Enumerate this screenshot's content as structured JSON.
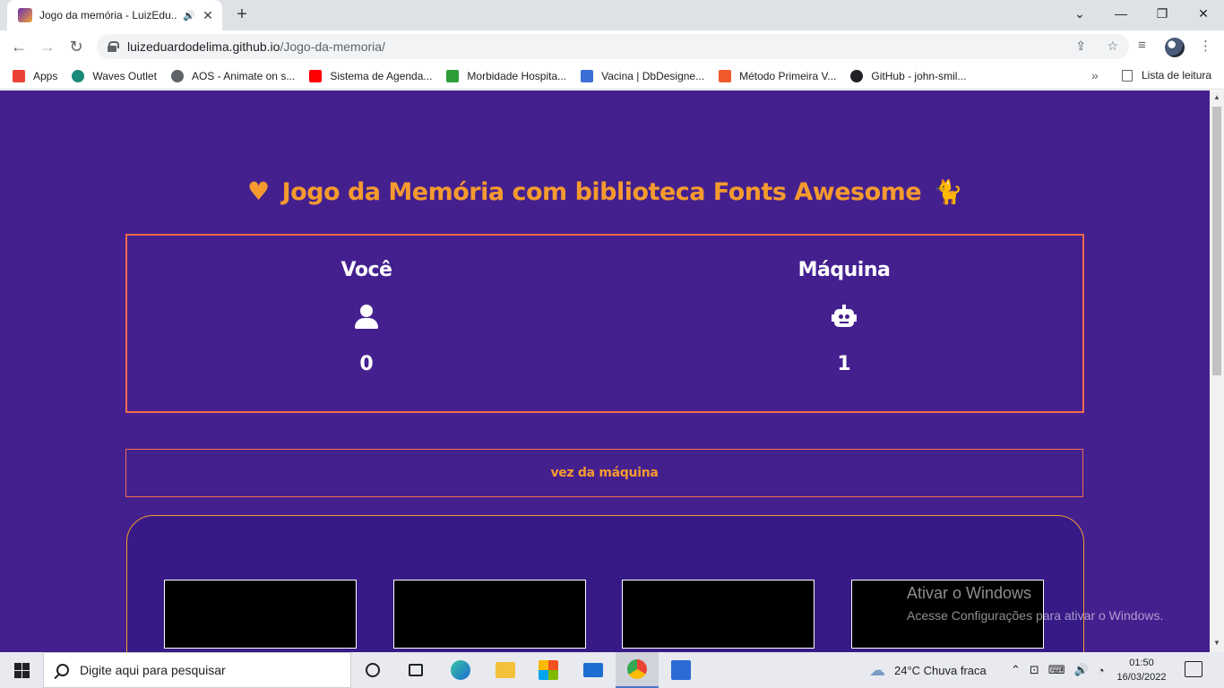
{
  "browser": {
    "tab_title": "Jogo da memória - LuizEdu...",
    "url_host": "luizeduardodelima.github.io",
    "url_path": "/Jogo-da-memoria/",
    "new_tab_symbol": "+",
    "bookmarks": [
      {
        "label": "Apps",
        "icon": "apps-grid-icon",
        "color": "#ea4335"
      },
      {
        "label": "Waves Outlet",
        "icon": "waves-outlet-icon",
        "color": "#1a8a7a"
      },
      {
        "label": "AOS - Animate on s...",
        "icon": "globe-icon",
        "color": "#5f6368"
      },
      {
        "label": "Sistema de Agenda...",
        "icon": "youtube-icon",
        "color": "#ff0000"
      },
      {
        "label": "Morbidade Hospita...",
        "icon": "health-cross-icon",
        "color": "#2e9d3a"
      },
      {
        "label": "Vacina | DbDesigne...",
        "icon": "dbdesigner-icon",
        "color": "#3c6ed6"
      },
      {
        "label": "Método Primeira V...",
        "icon": "flame-icon",
        "color": "#f0592b"
      },
      {
        "label": "GitHub - john-smil...",
        "icon": "github-icon",
        "color": "#202124"
      }
    ],
    "reading_list": "Lista de leitura"
  },
  "game": {
    "title": "Jogo da Memória com biblioteca Fonts Awesome",
    "players": [
      {
        "name": "Você",
        "icon": "user-icon",
        "score": "0"
      },
      {
        "name": "Máquina",
        "icon": "robot-icon",
        "score": "1"
      }
    ],
    "turn": "vez da máquina",
    "cards_visible": 4,
    "colors": {
      "background": "#44208f",
      "accent": "#f59a2e",
      "border": "#f26b4e",
      "card": "#000000"
    }
  },
  "watermark": {
    "line1": "Ativar o Windows",
    "line2": "Acesse Configurações para ativar o Windows."
  },
  "taskbar": {
    "search_placeholder": "Digite aqui para pesquisar",
    "weather": "24°C  Chuva fraca",
    "time": "01:50",
    "date": "16/03/2022"
  }
}
